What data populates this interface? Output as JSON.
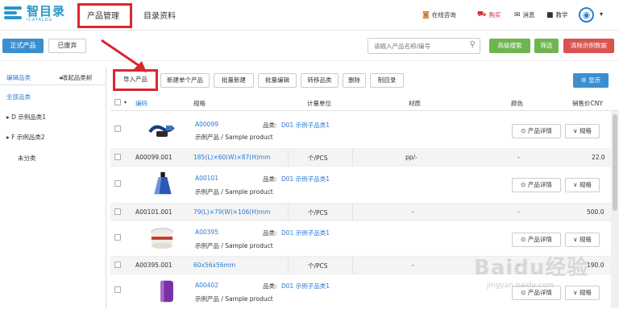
{
  "header": {
    "logo_cn": "智目录",
    "logo_en": "iCATALOG",
    "nav": [
      "产品管理",
      "目录资料"
    ],
    "tools": [
      {
        "icon": "consult-icon",
        "label": "在线咨询"
      },
      {
        "icon": "cart-icon",
        "label": "购买"
      },
      {
        "icon": "message-icon",
        "label": "消息"
      },
      {
        "icon": "video-icon",
        "label": "教学"
      }
    ]
  },
  "subbar": {
    "formal_label": "正式产品",
    "discarded_label": "已废弃",
    "search_placeholder": "请输入产品名称/编号",
    "advanced_label": "高级搜索",
    "filter_label": "筛选",
    "clear_label": "清除示例数据"
  },
  "sidebar": {
    "tabs": [
      "编辑品类",
      "◂收起品类树"
    ],
    "items": [
      "全部品类",
      "▸ D 示例品类1",
      "▸ F 示例品类2",
      "未分类"
    ]
  },
  "toolbar": {
    "buttons": [
      "导入产品",
      "新建单个产品",
      "批量新建",
      "批量编辑",
      "转移品类",
      "删除",
      "制目录"
    ],
    "show_label": "显示"
  },
  "table": {
    "headers": [
      "编码",
      "规格",
      "计量单位",
      "材质",
      "颜色",
      "销售价CNY"
    ],
    "rows": [
      {
        "kind": "prod",
        "code": "A00099",
        "cat_label": "品类:",
        "cat": "D01 示例子品类1",
        "sub": "示例产品 / Sample product",
        "detail_label": "产品详情",
        "spec_label": "规格"
      },
      {
        "kind": "spec",
        "code": "A00099.001",
        "spec": "185(L)×60(W)×87(H)mm",
        "unit": "个/PCS",
        "material": "pp/-",
        "color": "-",
        "price": "22.0"
      },
      {
        "kind": "prod",
        "code": "A00101",
        "cat_label": "品类:",
        "cat": "D01 示例子品类1",
        "sub": "示例产品 / Sample product",
        "detail_label": "产品详情",
        "spec_label": "规格"
      },
      {
        "kind": "spec",
        "code": "A00101.001",
        "spec": "79(L)×79(W)×106(H)mm",
        "unit": "个/PCS",
        "material": "-",
        "color": "-",
        "price": "500.0"
      },
      {
        "kind": "prod",
        "code": "A00395",
        "cat_label": "品类:",
        "cat": "D01 示例子品类1",
        "sub": "示例产品 / Sample product",
        "detail_label": "产品详情",
        "spec_label": "规格"
      },
      {
        "kind": "spec",
        "code": "A00395.001",
        "spec": "60x56x56mm",
        "unit": "个/PCS",
        "material": "-",
        "color": "-",
        "price": "190.0"
      },
      {
        "kind": "prod",
        "code": "A00402",
        "cat_label": "品类:",
        "cat": "D01 示例子品类1",
        "sub": "示例产品 / Sample product",
        "detail_label": "产品详情",
        "spec_label": "规格"
      }
    ]
  },
  "watermark": {
    "main": "Baidu经验",
    "sub": "jingyan.baidu.com"
  },
  "colors": {
    "accent": "#2b7bd4",
    "primary_button": "#3b8fd0",
    "green": "#6fb44f",
    "red": "#d9534f",
    "highlight": "#d9272e"
  }
}
